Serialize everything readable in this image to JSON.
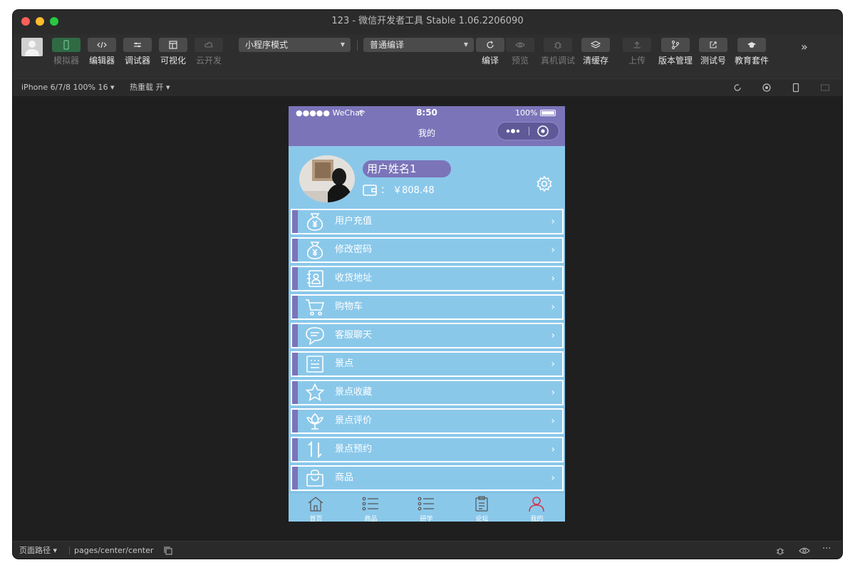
{
  "window": {
    "title": "123 - 微信开发者工具 Stable 1.06.2206090"
  },
  "toolbar": {
    "simulator": "模拟器",
    "editor": "编辑器",
    "debugger": "调试器",
    "visual": "可视化",
    "cloud": "云开发",
    "mode_select": "小程序模式",
    "compile_select": "普通编译",
    "compile": "编译",
    "preview": "预览",
    "remote_debug": "真机调试",
    "clear_cache": "清缓存",
    "upload": "上传",
    "version": "版本管理",
    "test_account": "测试号",
    "edu": "教育套件"
  },
  "subbar": {
    "device": "iPhone 6/7/8 100% 16 ▾",
    "hot_reload": "热重载 开 ▾"
  },
  "statusbar": {
    "path_label": "页面路径 ▾",
    "path": "pages/center/center"
  },
  "phone": {
    "carrier": "●●●●● WeChat",
    "time": "8:50",
    "battery": "100%",
    "nav_title": "我的",
    "username": "用户姓名1",
    "balance": "： ￥808.48",
    "menu": [
      {
        "label": "用户充值",
        "icon": "money-bag-icon"
      },
      {
        "label": "修改密码",
        "icon": "money-bag-icon"
      },
      {
        "label": "收货地址",
        "icon": "address-book-icon"
      },
      {
        "label": "购物车",
        "icon": "cart-icon"
      },
      {
        "label": "客服聊天",
        "icon": "chat-icon"
      },
      {
        "label": "景点",
        "icon": "list-board-icon"
      },
      {
        "label": "景点收藏",
        "icon": "star-icon"
      },
      {
        "label": "景点评价",
        "icon": "flower-icon"
      },
      {
        "label": "景点预约",
        "icon": "sort-icon"
      },
      {
        "label": "商品",
        "icon": "bag-icon"
      }
    ],
    "tabs": [
      {
        "label": "首页",
        "icon": "home-icon"
      },
      {
        "label": "商品",
        "icon": "list-icon"
      },
      {
        "label": "研学",
        "icon": "list-icon"
      },
      {
        "label": "论坛",
        "icon": "clipboard-icon"
      },
      {
        "label": "我的",
        "icon": "person-icon"
      }
    ]
  },
  "colors": {
    "nav_purple": "#7b74b9",
    "page_blue": "#8ac8ea",
    "active_tab": "#d2344a"
  }
}
